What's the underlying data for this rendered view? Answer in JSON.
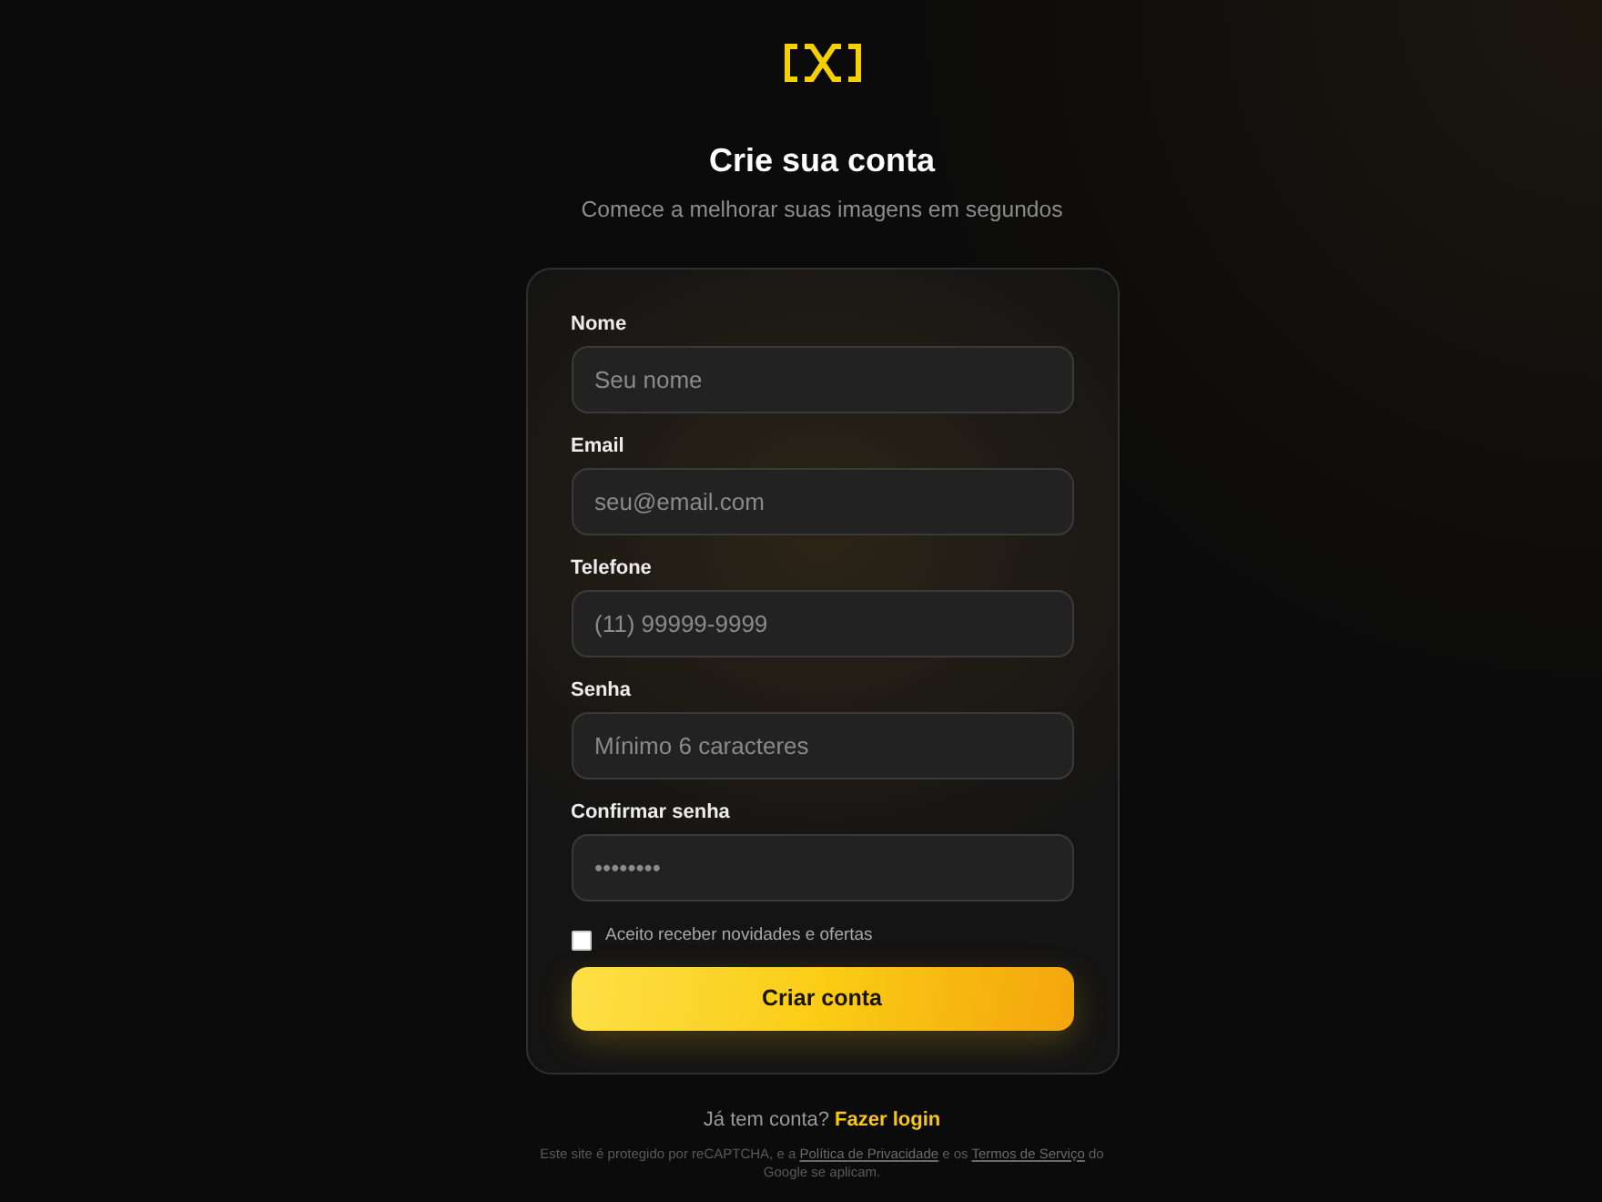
{
  "header": {
    "title": "Crie sua conta",
    "subtitle": "Comece a melhorar suas imagens em segundos"
  },
  "form": {
    "fields": [
      {
        "label": "Nome",
        "placeholder": "Seu nome"
      },
      {
        "label": "Email",
        "placeholder": "seu@email.com"
      },
      {
        "label": "Telefone",
        "placeholder": "(11) 99999-9999"
      },
      {
        "label": "Senha",
        "placeholder": "Mínimo 6 caracteres"
      },
      {
        "label": "Confirmar senha",
        "placeholder": "••••••••"
      }
    ],
    "newsletter": {
      "label": "Aceito receber novidades e ofertas",
      "checked": false
    },
    "submit": "Criar conta"
  },
  "login_prompt": {
    "text": "Já tem conta?",
    "link": "Fazer login"
  },
  "legal": {
    "text_before": "Este site é protegido por reCAPTCHA, e a",
    "privacy_link": "Política de Privacidade",
    "text_middle": "e os",
    "terms_link": "Termos de Serviço",
    "text_after": "do Google se aplicam."
  }
}
